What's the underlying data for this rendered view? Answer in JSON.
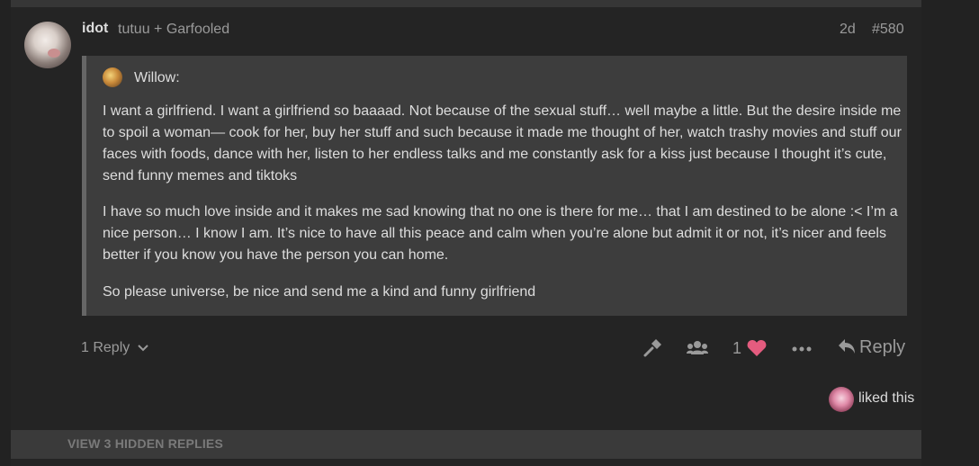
{
  "post": {
    "username": "idot",
    "full_name": "tutuu + Garfooled",
    "date": "2d",
    "number": "#580"
  },
  "quote": {
    "author": "Willow:",
    "paragraphs": [
      "I want a girlfriend. I want a girlfriend so baaaad. Not because of the sexual stuff… well maybe a little. But the desire inside me to spoil a woman— cook for her, buy her stuff and such because it made me thought of her, watch trashy movies and stuff our faces with foods, dance with her, listen to her endless talks and me constantly ask for a kiss just because I thought it’s cute, send funny memes and tiktoks",
      "I have so much love inside and it makes me sad knowing that no one is there for me… that I am destined to be alone :< I’m a nice person… I know I am. It’s nice to have all this peace and calm when you’re alone but admit it or not, it’s nicer and feels better if you know you have the person you can home.",
      "So please universe, be nice and send me a kind and funny girlfriend"
    ]
  },
  "actions": {
    "replies_label": "1 Reply",
    "like_count": "1",
    "reply_label": "Reply"
  },
  "likes": {
    "text": "liked this"
  },
  "hidden_replies": {
    "label": "VIEW 3 HIDDEN REPLIES"
  },
  "colors": {
    "background": "#222222",
    "quote_bg": "#3d3d3d",
    "heart": "#e45c7f",
    "muted_text": "#9a9a9a",
    "body_text": "#dddddd"
  },
  "icons": [
    "chevron-down-icon",
    "wrench-icon",
    "group-icon",
    "heart-icon",
    "more-icon",
    "reply-arrow-icon"
  ]
}
